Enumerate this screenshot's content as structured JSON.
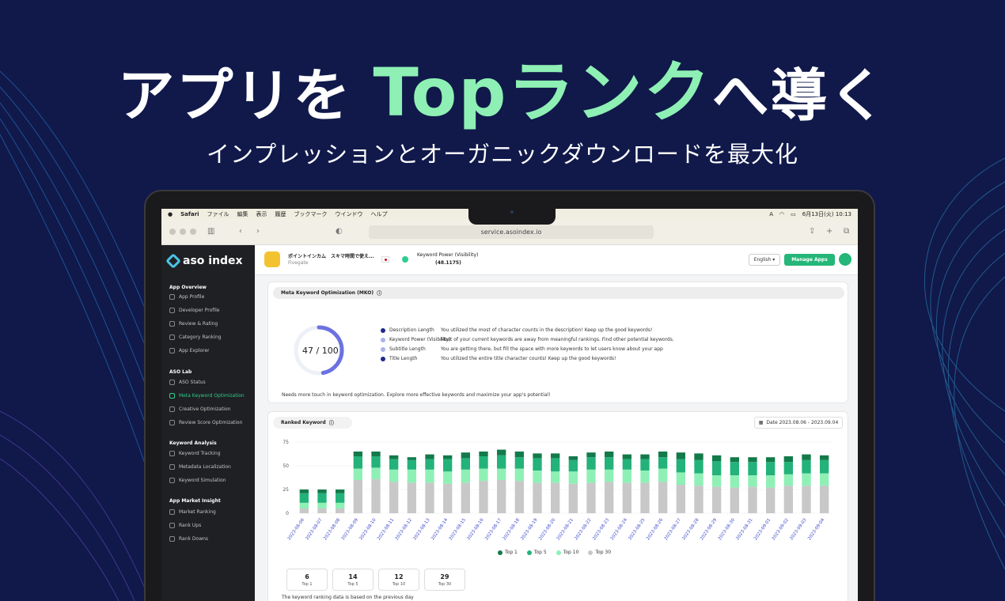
{
  "hero": {
    "title_pre": "アプリを",
    "title_accent": "Top",
    "title_mid": "ランク",
    "title_post": "へ導く",
    "subtitle": "インプレッションとオーガニックダウンロードを最大化"
  },
  "mac_menubar": {
    "items": [
      "Safari",
      "ファイル",
      "編集",
      "表示",
      "履歴",
      "ブックマーク",
      "ウインドウ",
      "ヘルプ"
    ],
    "datetime": "6月13日(火) 10:13"
  },
  "browser": {
    "url": "service.asoindex.io"
  },
  "sidebar": {
    "logo": "aso index",
    "sections": [
      {
        "title": "App Overview",
        "items": [
          "App Profile",
          "Developer Profile",
          "Review & Rating",
          "Category Ranking",
          "App Explorer"
        ]
      },
      {
        "title": "ASO Lab",
        "items": [
          "ASO Status",
          "Meta Keyword Optimization",
          "Creative Optimization",
          "Review Score Optimization"
        ]
      },
      {
        "title": "Keyword Analysis",
        "items": [
          "Keyword Tracking",
          "Metadata Localization",
          "Keyword Simulation"
        ]
      },
      {
        "title": "App Market Insight",
        "items": [
          "Market Ranking",
          "Rank Ups",
          "Rank Downs"
        ]
      }
    ],
    "active": "Meta Keyword Optimization"
  },
  "topbar": {
    "app_name": "ポイントインカム　スキマ時間で使え...",
    "developer": "Fivegate",
    "kp_label": "Keyword Power (Visibility)",
    "kp_value": "(48.1175)",
    "language": "English",
    "manage_label": "Manage Apps"
  },
  "mko": {
    "title": "Meta Keyword Optimization (MKO)",
    "score": "47 / 100",
    "score_value": 47,
    "lines": [
      {
        "name": "Description Length",
        "color": "#1f2a8a",
        "text": "You utilized the most of character counts in the description! Keep up the good keywords!"
      },
      {
        "name": "Keyword Power (Visibility)",
        "color": "#aab2ea",
        "text": "Most of your current keywords are away from meaningful rankings. Find other potential keywords."
      },
      {
        "name": "Subtitle Length",
        "color": "#aab2ea",
        "text": "You are getting there, but fill the space with more keywords to let users know about your app"
      },
      {
        "name": "Title Length",
        "color": "#1f2a8a",
        "text": "You utilized the entire title character counts! Keep up the good keywords!"
      }
    ],
    "footer": "Needs more touch in keyword optimization. Explore more effective keywords and maximize your app's potential!"
  },
  "ranked": {
    "title": "Ranked Keyword",
    "date_range": "Date 2023.08.06 - 2023.09.04",
    "note": "The keyword ranking data is based on the previous day"
  },
  "stats": [
    {
      "value": "6",
      "label": "Top 1"
    },
    {
      "value": "14",
      "label": "Top 5"
    },
    {
      "value": "12",
      "label": "Top 10"
    },
    {
      "value": "29",
      "label": "Top 30"
    }
  ],
  "chart_data": {
    "type": "bar",
    "stacked": true,
    "categories": [
      "2023-08-06",
      "2023-08-07",
      "2023-08-08",
      "2023-08-09",
      "2023-08-10",
      "2023-08-11",
      "2023-08-12",
      "2023-08-13",
      "2023-08-14",
      "2023-08-15",
      "2023-08-16",
      "2023-08-17",
      "2023-08-18",
      "2023-08-19",
      "2023-08-20",
      "2023-08-21",
      "2023-08-22",
      "2023-08-23",
      "2023-08-24",
      "2023-08-25",
      "2023-08-26",
      "2023-08-27",
      "2023-08-28",
      "2023-08-29",
      "2023-08-30",
      "2023-08-31",
      "2023-09-01",
      "2023-09-02",
      "2023-09-03",
      "2023-09-04"
    ],
    "series": [
      {
        "name": "Top 30",
        "color": "#c8c8c8",
        "values": [
          5,
          5,
          5,
          35,
          36,
          33,
          32,
          32,
          31,
          32,
          34,
          35,
          34,
          32,
          32,
          31,
          32,
          33,
          32,
          32,
          33,
          30,
          29,
          28,
          27,
          28,
          27,
          29,
          29,
          29
        ]
      },
      {
        "name": "Top 10",
        "color": "#8ff0b6",
        "values": [
          6,
          6,
          6,
          12,
          12,
          13,
          14,
          14,
          13,
          14,
          13,
          12,
          13,
          13,
          12,
          13,
          14,
          13,
          14,
          13,
          14,
          13,
          13,
          12,
          13,
          12,
          13,
          12,
          13,
          13
        ]
      },
      {
        "name": "Top 5",
        "color": "#23b27a",
        "values": [
          10,
          10,
          10,
          13,
          12,
          11,
          10,
          11,
          13,
          12,
          13,
          14,
          12,
          13,
          14,
          12,
          13,
          13,
          11,
          12,
          12,
          14,
          14,
          15,
          14,
          14,
          14,
          13,
          14,
          14
        ]
      },
      {
        "name": "Top 1",
        "color": "#137a4a",
        "values": [
          4,
          4,
          4,
          5,
          5,
          4,
          3,
          5,
          4,
          6,
          5,
          6,
          6,
          5,
          5,
          4,
          5,
          6,
          5,
          5,
          6,
          7,
          7,
          6,
          5,
          5,
          5,
          6,
          6,
          5
        ]
      }
    ],
    "yticks": [
      0,
      25,
      50,
      75
    ],
    "ylim": [
      0,
      75
    ],
    "legend_position": "bottom"
  }
}
